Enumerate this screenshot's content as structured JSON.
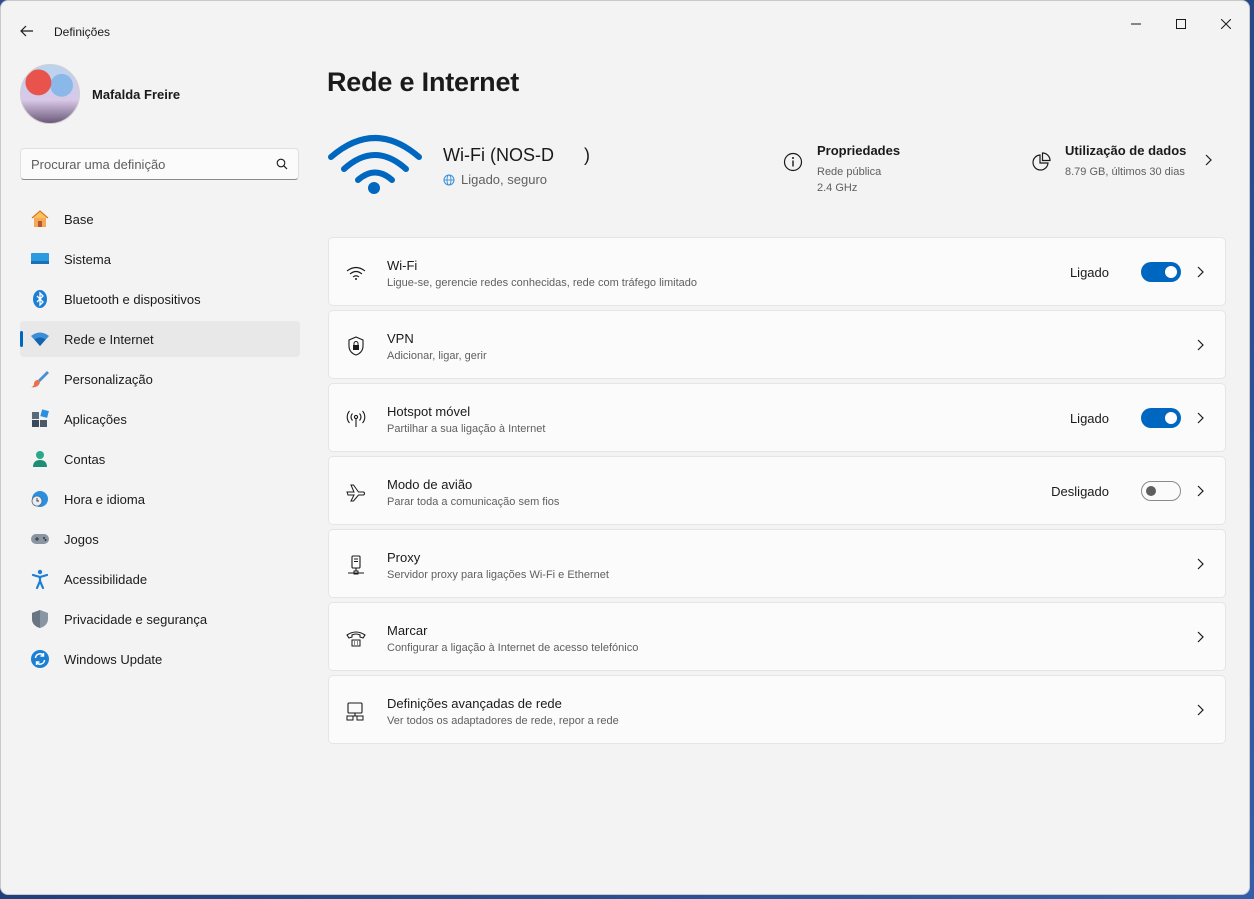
{
  "window": {
    "app_title": "Definições"
  },
  "profile": {
    "name": "Mafalda Freire"
  },
  "search": {
    "placeholder": "Procurar uma definição"
  },
  "nav": [
    {
      "label": "Base",
      "icon": "home-icon"
    },
    {
      "label": "Sistema",
      "icon": "system-icon"
    },
    {
      "label": "Bluetooth e dispositivos",
      "icon": "bluetooth-icon"
    },
    {
      "label": "Rede e Internet",
      "icon": "network-icon",
      "active": true
    },
    {
      "label": "Personalização",
      "icon": "brush-icon"
    },
    {
      "label": "Aplicações",
      "icon": "apps-icon"
    },
    {
      "label": "Contas",
      "icon": "account-icon"
    },
    {
      "label": "Hora e idioma",
      "icon": "clock-globe-icon"
    },
    {
      "label": "Jogos",
      "icon": "gamepad-icon"
    },
    {
      "label": "Acessibilidade",
      "icon": "accessibility-icon"
    },
    {
      "label": "Privacidade e segurança",
      "icon": "shield-icon"
    },
    {
      "label": "Windows Update",
      "icon": "update-icon"
    }
  ],
  "page": {
    "title": "Rede e Internet"
  },
  "hero": {
    "ssid": "Wi-Fi (NOS-D      )",
    "status": "Ligado, seguro",
    "properties": {
      "title": "Propriedades",
      "line1": "Rede pública",
      "line2": "2.4 GHz"
    },
    "usage": {
      "title": "Utilização de dados",
      "line1": "8.79 GB, últimos 30 dias"
    }
  },
  "cards": [
    {
      "title": "Wi-Fi",
      "sub": "Ligue-se, gerencie redes conhecidas, rede com tráfego limitado",
      "status": "Ligado",
      "toggle": "on",
      "icon": "wifi-icon"
    },
    {
      "title": "VPN",
      "sub": "Adicionar, ligar, gerir",
      "status": "",
      "toggle": "none",
      "icon": "vpn-shield-icon"
    },
    {
      "title": "Hotspot móvel",
      "sub": "Partilhar a sua ligação à Internet",
      "status": "Ligado",
      "toggle": "on",
      "icon": "hotspot-icon"
    },
    {
      "title": "Modo de avião",
      "sub": "Parar toda a comunicação sem fios",
      "status": "Desligado",
      "toggle": "off",
      "icon": "airplane-icon"
    },
    {
      "title": "Proxy",
      "sub": "Servidor proxy para ligações Wi-Fi e Ethernet",
      "status": "",
      "toggle": "none",
      "icon": "proxy-icon"
    },
    {
      "title": "Marcar",
      "sub": "Configurar a ligação à Internet de acesso telefónico",
      "status": "",
      "toggle": "none",
      "icon": "dialup-icon"
    },
    {
      "title": "Definições avançadas de rede",
      "sub": "Ver todos os adaptadores de rede, repor a rede",
      "status": "",
      "toggle": "none",
      "icon": "network-adapter-icon"
    }
  ],
  "colors": {
    "accent": "#0067c0",
    "window_bg": "#f3f3f3",
    "card_bg": "#fbfbfb"
  }
}
